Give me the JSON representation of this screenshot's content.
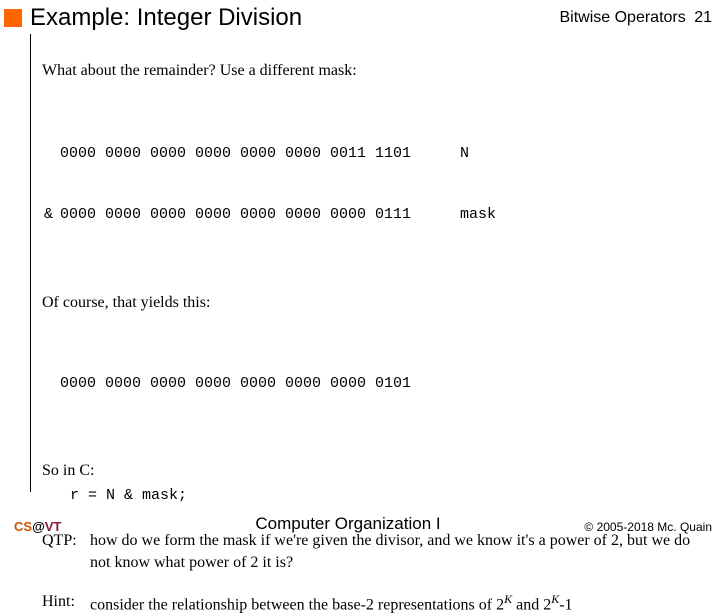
{
  "header": {
    "title": "Example: Integer Division",
    "section": "Bitwise Operators",
    "page": "21"
  },
  "body": {
    "intro": "What about the remainder?  Use a different mask:",
    "bits_row_n": "0000 0000 0000 0000 0000 0000 0011 1101",
    "bits_row_mask": "0000 0000 0000 0000 0000 0000 0000 0111",
    "amp": "&",
    "label_n": "N",
    "label_mask": "mask",
    "ofcourse": "Of course, that yields this:",
    "bits_result": "0000 0000 0000 0000 0000 0000 0000 0101",
    "soinc": "So in C:",
    "c_code": "r = N & mask;",
    "qtp_label": "QTP:",
    "qtp_text": "how do we form the mask if we're given the divisor, and we know it's a power of 2, but we do not know what power of 2 it is?",
    "hint_label": "Hint:",
    "hint_prefix": "consider the relationship between the base-2 representations of 2",
    "hint_mid": " and 2",
    "hint_exp_k": "K",
    "hint_suffix": "-1"
  },
  "footer": {
    "cs": "CS",
    "at": "@",
    "vt": "VT",
    "course": "Computer Organization I",
    "copyright": "© 2005-2018 Mc. Quain"
  }
}
